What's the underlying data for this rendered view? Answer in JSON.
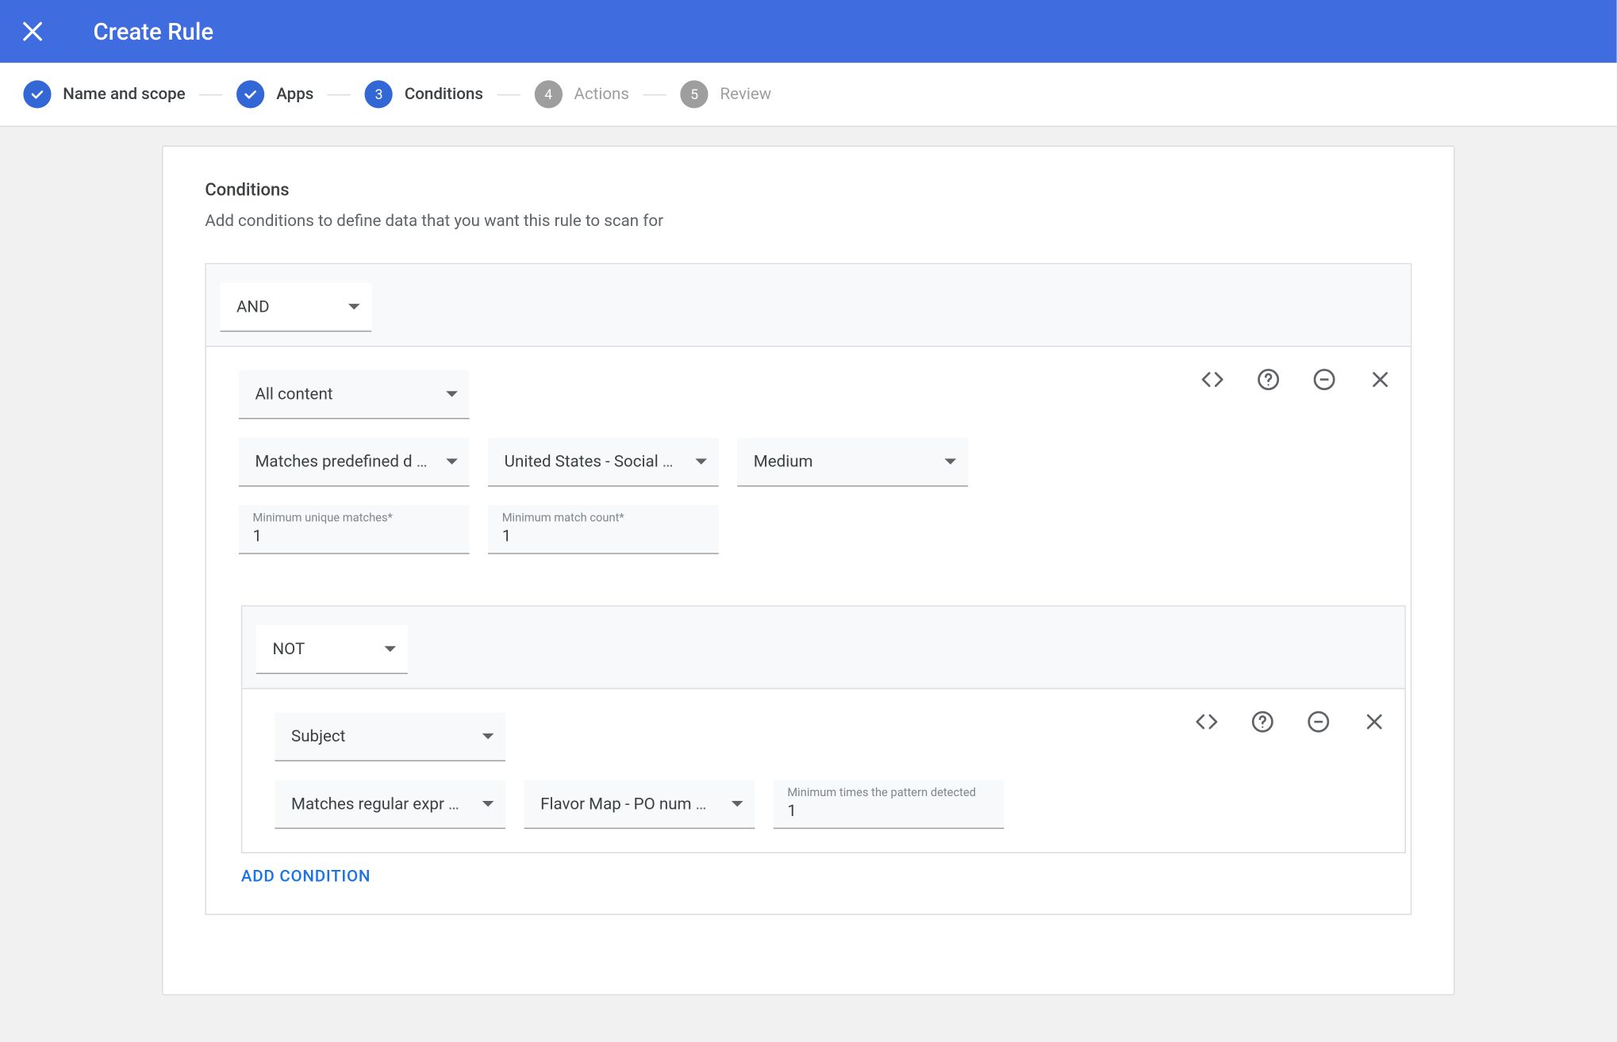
{
  "header": {
    "title": "Create Rule"
  },
  "stepper": {
    "steps": [
      {
        "label": "Name and scope",
        "state": "done"
      },
      {
        "label": "Apps",
        "state": "done"
      },
      {
        "label": "Conditions",
        "state": "current",
        "num": "3"
      },
      {
        "label": "Actions",
        "state": "future",
        "num": "4"
      },
      {
        "label": "Review",
        "state": "future",
        "num": "5"
      }
    ]
  },
  "section": {
    "title": "Conditions",
    "subtitle": "Add conditions to define data that you want this rule to scan for"
  },
  "group1": {
    "operator": "AND",
    "scope": "All content",
    "matchType": "Matches predefined d",
    "classifier": "United States - Social",
    "confidence": "Medium",
    "minUnique": {
      "label": "Minimum unique matches*",
      "value": "1"
    },
    "minCount": {
      "label": "Minimum match count*",
      "value": "1"
    }
  },
  "group2": {
    "operator": "NOT",
    "scope": "Subject",
    "matchType": "Matches regular expr",
    "pattern": "Flavor Map - PO num",
    "minDetected": {
      "label": "Minimum times the pattern detected",
      "value": "1"
    }
  },
  "actions": {
    "addCondition": "ADD CONDITION"
  }
}
